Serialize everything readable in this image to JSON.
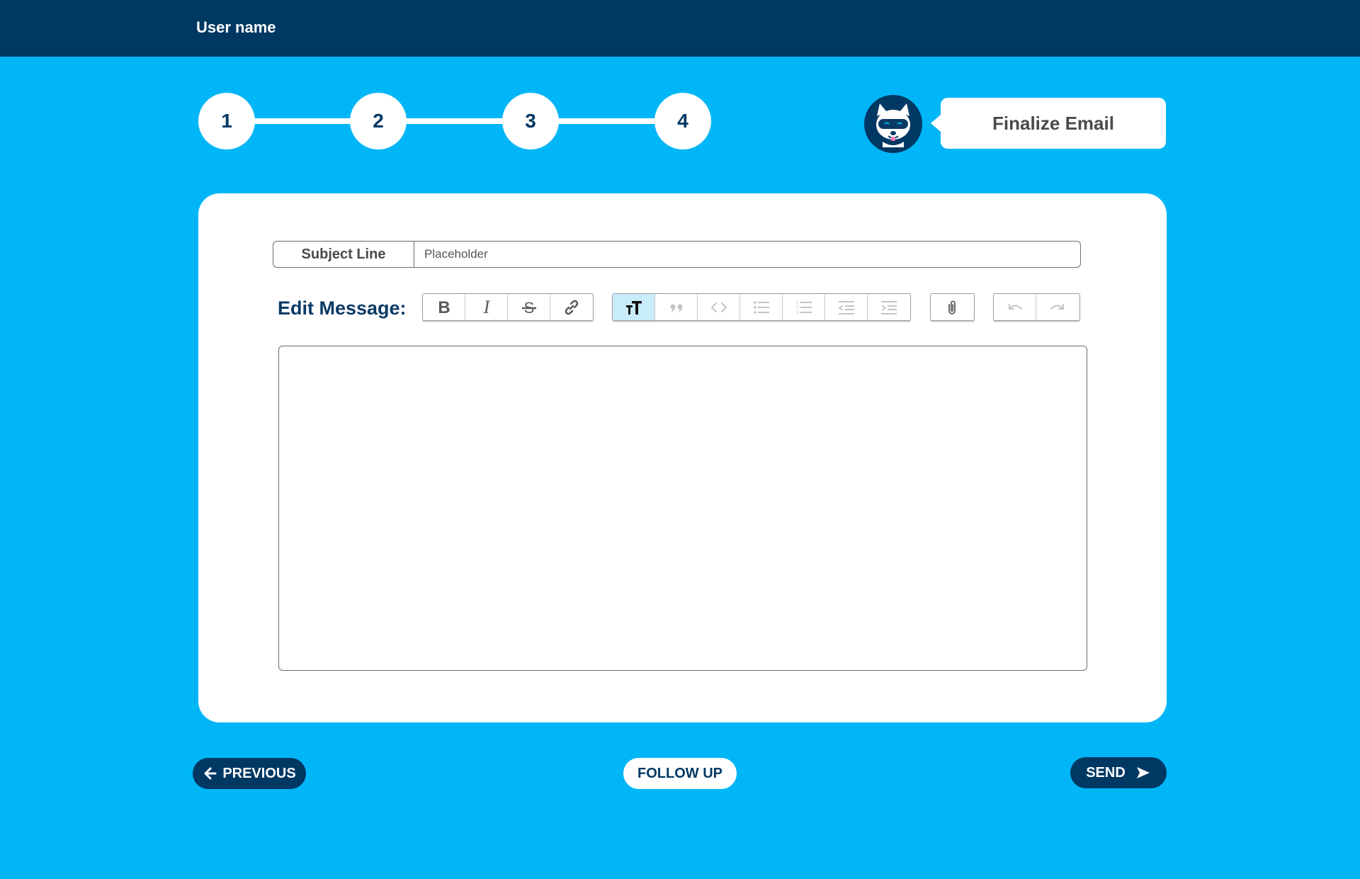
{
  "header": {
    "username": "User name"
  },
  "stepper": {
    "steps": [
      "1",
      "2",
      "3",
      "4"
    ]
  },
  "assistant": {
    "message": "Finalize Email"
  },
  "subject": {
    "label": "Subject Line",
    "placeholder": "Placeholder",
    "value": ""
  },
  "editor": {
    "label": "Edit Message:",
    "toolbar_groups": [
      [
        "bold-icon",
        "italic-icon",
        "strikethrough-icon",
        "link-icon"
      ],
      [
        "text-size-icon",
        "quote-icon",
        "code-icon",
        "bullet-list-icon",
        "numbered-list-icon",
        "outdent-icon",
        "indent-icon"
      ],
      [
        "attachment-icon"
      ],
      [
        "undo-icon",
        "redo-icon"
      ]
    ],
    "active_tool": "text-size-icon",
    "body": ""
  },
  "actions": {
    "previous": "PREVIOUS",
    "follow_up": "FOLLOW UP",
    "send": "SEND"
  },
  "colors": {
    "background": "#00b6f7",
    "navy": "#003864",
    "active_tool": "#c9ecfb"
  }
}
